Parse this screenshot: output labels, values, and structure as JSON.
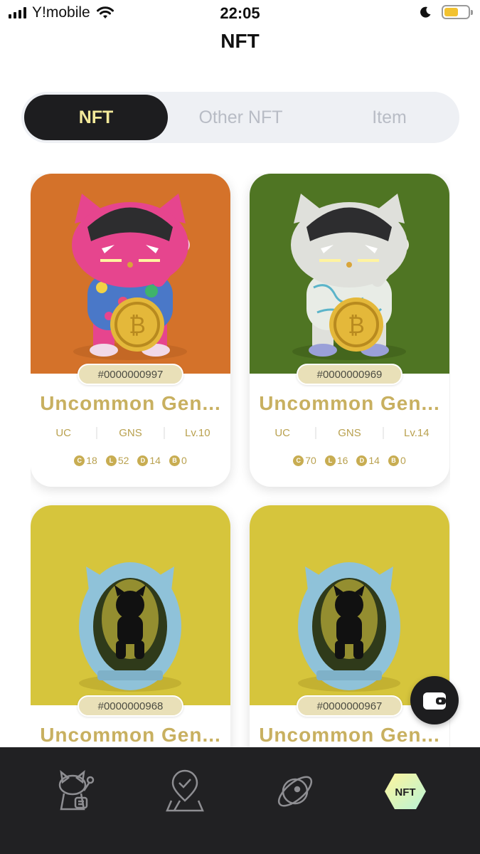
{
  "status_bar": {
    "carrier": "Y!mobile",
    "time": "22:05",
    "battery_percent": 60
  },
  "header": {
    "title": "NFT"
  },
  "tabs": [
    {
      "label": "NFT",
      "active": true
    },
    {
      "label": "Other NFT",
      "active": false
    },
    {
      "label": "Item",
      "active": false
    }
  ],
  "cards": [
    {
      "serial": "#0000000997",
      "name": "Uncommon Gen...",
      "rarity": "UC",
      "type": "GNS",
      "level": "Lv.10",
      "stats": [
        {
          "icon": "C",
          "value": "18"
        },
        {
          "icon": "L",
          "value": "52"
        },
        {
          "icon": "D",
          "value": "14"
        },
        {
          "icon": "B",
          "value": "0"
        }
      ],
      "bg_color": "#d4722a",
      "figure": "pink-robot-cat"
    },
    {
      "serial": "#0000000969",
      "name": "Uncommon Gen...",
      "rarity": "UC",
      "type": "GNS",
      "level": "Lv.14",
      "stats": [
        {
          "icon": "C",
          "value": "70"
        },
        {
          "icon": "L",
          "value": "16"
        },
        {
          "icon": "D",
          "value": "14"
        },
        {
          "icon": "B",
          "value": "0"
        }
      ],
      "bg_color": "#4f7523",
      "figure": "white-robot-cat"
    },
    {
      "serial": "#0000000968",
      "name": "Uncommon Gen...",
      "bg_color": "#d6c53c",
      "figure": "blue-egg-capsule"
    },
    {
      "serial": "#0000000967",
      "name": "Uncommon Gen...",
      "bg_color": "#d6c53c",
      "figure": "blue-egg-capsule"
    }
  ],
  "colors": {
    "accent_gold": "#c8b060",
    "tab_active_bg": "#1d1d1f",
    "tab_active_text": "#f4ea9a",
    "nav_bg": "#212123"
  },
  "bottom_nav": [
    {
      "icon": "lucky-cat-icon"
    },
    {
      "icon": "map-pin-check-icon"
    },
    {
      "icon": "orbit-icon"
    },
    {
      "icon": "nft-badge-icon",
      "label": "NFT",
      "active": true
    }
  ]
}
